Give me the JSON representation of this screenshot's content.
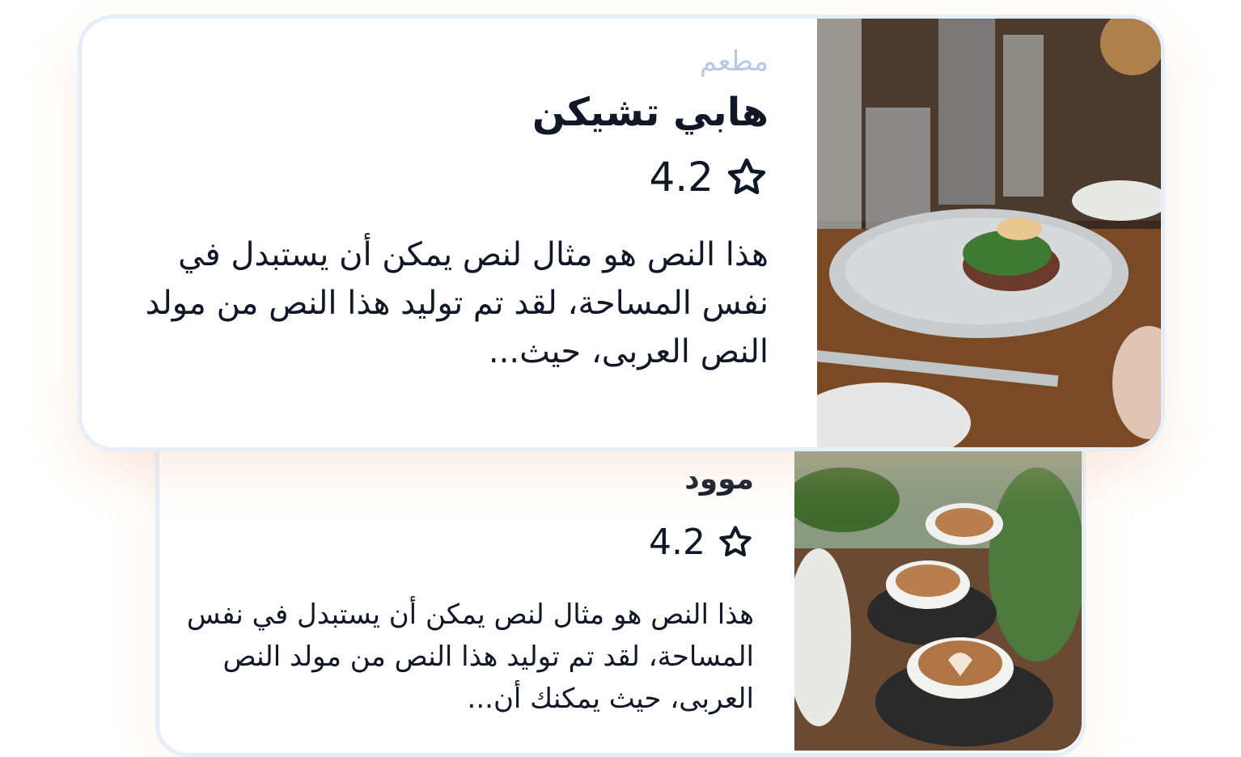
{
  "cards": [
    {
      "category": "مطعم",
      "title": "هابي تشيكن",
      "rating": "4.2",
      "description": "هذا النص هو مثال لنص يمكن أن يستبدل في نفس المساحة، لقد تم توليد هذا النص من مولد النص العربى، حيث...",
      "image_icon": "restaurant-dish-photo"
    },
    {
      "title": "موود",
      "rating": "4.2",
      "description": "هذا النص هو مثال لنص يمكن أن يستبدل في نفس المساحة، لقد تم توليد هذا النص من مولد النص العربى، حيث يمكنك أن...",
      "image_icon": "coffee-cups-photo"
    }
  ],
  "colors": {
    "category": "#b9c8e9",
    "text": "#101828",
    "border": "#e6eefa"
  },
  "star_icon": "star-outline-icon"
}
